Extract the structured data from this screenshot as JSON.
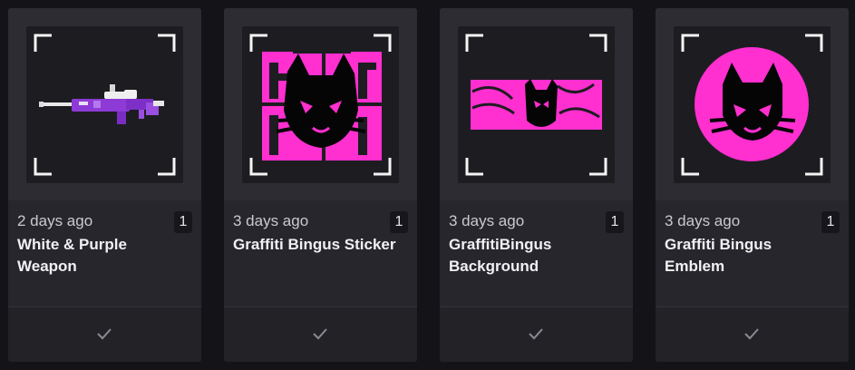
{
  "cards": [
    {
      "time": "2 days ago",
      "title": "White & Purple Weapon",
      "quantity": "1",
      "icon": "check-icon"
    },
    {
      "time": "3 days ago",
      "title": "Graffiti Bingus Sticker",
      "quantity": "1",
      "icon": "check-icon"
    },
    {
      "time": "3 days ago",
      "title": "GraffitiBingus Background",
      "quantity": "1",
      "icon": "check-icon"
    },
    {
      "time": "3 days ago",
      "title": "Graffiti Bingus Emblem",
      "quantity": "1",
      "icon": "check-icon"
    }
  ],
  "colors": {
    "accent_pink": "#ff2fd0",
    "purple": "#8d3ad6",
    "card": "#26262c",
    "background": "#141418"
  }
}
